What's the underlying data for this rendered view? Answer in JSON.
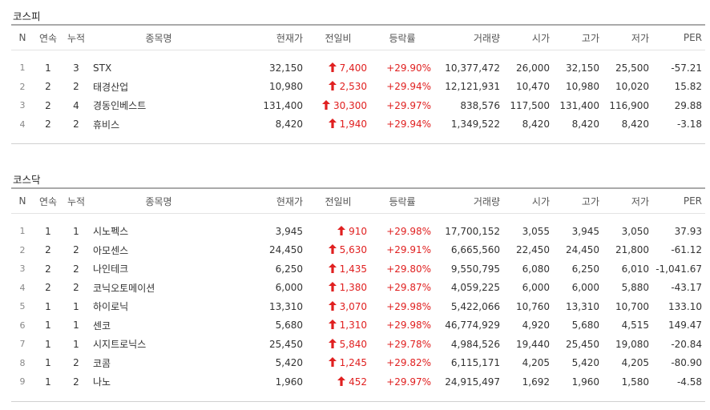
{
  "kospi": {
    "title": "코스피",
    "headers": [
      "N",
      "연속",
      "누적",
      "종목명",
      "현재가",
      "전일비",
      "등락률",
      "거래량",
      "시가",
      "고가",
      "저가",
      "PER"
    ],
    "rows": [
      {
        "n": "1",
        "cont": "1",
        "acc": "3",
        "name": "STX",
        "price": "32,150",
        "diff": "7,400",
        "rate": "+29.90%",
        "volume": "10,377,472",
        "open": "26,000",
        "high": "32,150",
        "low": "25,500",
        "per": "-57.21"
      },
      {
        "n": "2",
        "cont": "2",
        "acc": "2",
        "name": "태경산업",
        "price": "10,980",
        "diff": "2,530",
        "rate": "+29.94%",
        "volume": "12,121,931",
        "open": "10,470",
        "high": "10,980",
        "low": "10,020",
        "per": "15.82"
      },
      {
        "n": "3",
        "cont": "2",
        "acc": "4",
        "name": "경동인베스트",
        "price": "131,400",
        "diff": "30,300",
        "rate": "+29.97%",
        "volume": "838,576",
        "open": "117,500",
        "high": "131,400",
        "low": "116,900",
        "per": "29.88"
      },
      {
        "n": "4",
        "cont": "2",
        "acc": "2",
        "name": "휴비스",
        "price": "8,420",
        "diff": "1,940",
        "rate": "+29.94%",
        "volume": "1,349,522",
        "open": "8,420",
        "high": "8,420",
        "low": "8,420",
        "per": "-3.18"
      }
    ]
  },
  "kosdaq": {
    "title": "코스닥",
    "headers": [
      "N",
      "연속",
      "누적",
      "종목명",
      "현재가",
      "전일비",
      "등락률",
      "거래량",
      "시가",
      "고가",
      "저가",
      "PER"
    ],
    "rows": [
      {
        "n": "1",
        "cont": "1",
        "acc": "1",
        "name": "시노펙스",
        "price": "3,945",
        "diff": "910",
        "rate": "+29.98%",
        "volume": "17,700,152",
        "open": "3,055",
        "high": "3,945",
        "low": "3,050",
        "per": "37.93"
      },
      {
        "n": "2",
        "cont": "2",
        "acc": "2",
        "name": "아모센스",
        "price": "24,450",
        "diff": "5,630",
        "rate": "+29.91%",
        "volume": "6,665,560",
        "open": "22,450",
        "high": "24,450",
        "low": "21,800",
        "per": "-61.12"
      },
      {
        "n": "3",
        "cont": "2",
        "acc": "2",
        "name": "나인테크",
        "price": "6,250",
        "diff": "1,435",
        "rate": "+29.80%",
        "volume": "9,550,795",
        "open": "6,080",
        "high": "6,250",
        "low": "6,010",
        "per": "-1,041.67"
      },
      {
        "n": "4",
        "cont": "2",
        "acc": "2",
        "name": "코닉오토메이션",
        "price": "6,000",
        "diff": "1,380",
        "rate": "+29.87%",
        "volume": "4,059,225",
        "open": "6,000",
        "high": "6,000",
        "low": "5,880",
        "per": "-43.17"
      },
      {
        "n": "5",
        "cont": "1",
        "acc": "1",
        "name": "하이로닉",
        "price": "13,310",
        "diff": "3,070",
        "rate": "+29.98%",
        "volume": "5,422,066",
        "open": "10,760",
        "high": "13,310",
        "low": "10,700",
        "per": "133.10"
      },
      {
        "n": "6",
        "cont": "1",
        "acc": "1",
        "name": "센코",
        "price": "5,680",
        "diff": "1,310",
        "rate": "+29.98%",
        "volume": "46,774,929",
        "open": "4,920",
        "high": "5,680",
        "low": "4,515",
        "per": "149.47"
      },
      {
        "n": "7",
        "cont": "1",
        "acc": "1",
        "name": "시지트로닉스",
        "price": "25,450",
        "diff": "5,840",
        "rate": "+29.78%",
        "volume": "4,984,526",
        "open": "19,440",
        "high": "25,450",
        "low": "19,080",
        "per": "-20.84"
      },
      {
        "n": "8",
        "cont": "1",
        "acc": "2",
        "name": "코콤",
        "price": "5,420",
        "diff": "1,245",
        "rate": "+29.82%",
        "volume": "6,115,171",
        "open": "4,205",
        "high": "5,420",
        "low": "4,205",
        "per": "-80.90"
      },
      {
        "n": "9",
        "cont": "1",
        "acc": "2",
        "name": "나노",
        "price": "1,960",
        "diff": "452",
        "rate": "+29.97%",
        "volume": "24,915,497",
        "open": "1,692",
        "high": "1,960",
        "low": "1,580",
        "per": "-4.58"
      }
    ]
  },
  "colors": {
    "up": "#e02020",
    "header_border": "#aaaaaa",
    "row_line": "#e3e3e3"
  },
  "icons": {
    "up_arrow": "arrow-up-icon"
  }
}
